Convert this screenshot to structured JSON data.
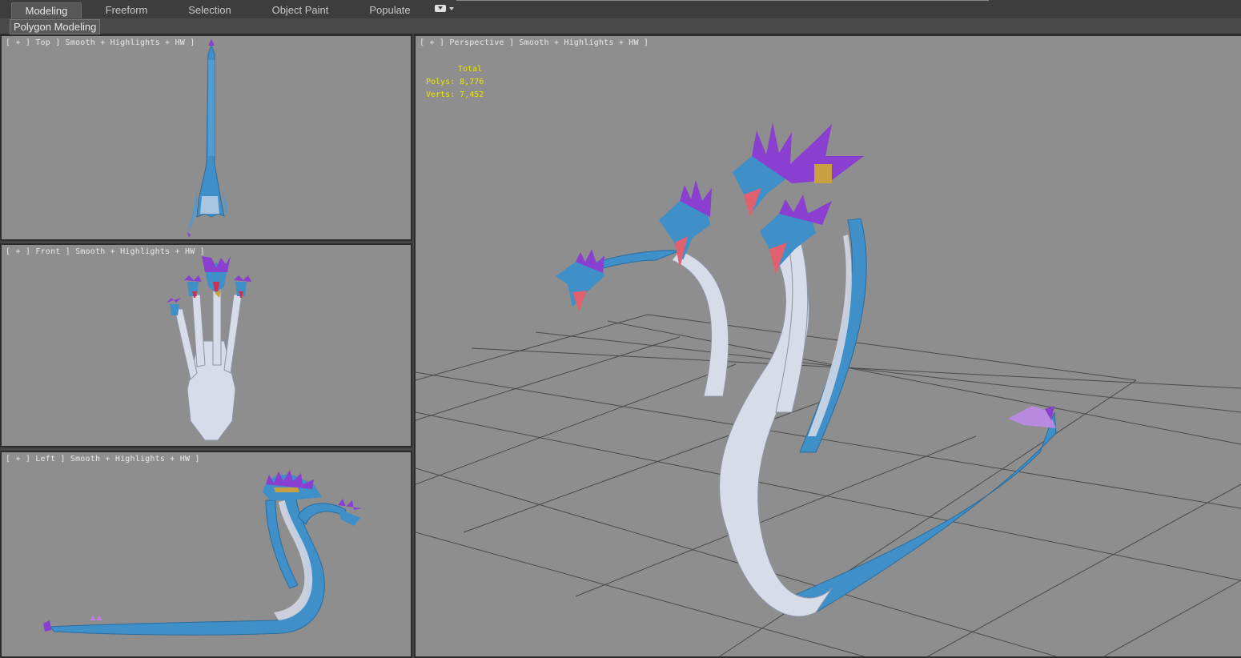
{
  "ribbon": {
    "tabs": [
      {
        "id": "modeling",
        "label": "Modeling",
        "active": true
      },
      {
        "id": "freeform",
        "label": "Freeform",
        "active": false
      },
      {
        "id": "selection",
        "label": "Selection",
        "active": false
      },
      {
        "id": "object-paint",
        "label": "Object Paint",
        "active": false
      },
      {
        "id": "populate",
        "label": "Populate",
        "active": false
      }
    ],
    "dropdown_icon": "ribbon-options-dropdown-icon"
  },
  "subribbon": {
    "panel_label": "Polygon Modeling"
  },
  "viewports": {
    "top": {
      "label": "[ + ] Top ] Smooth + Highlights + HW ]"
    },
    "front": {
      "label": "[ + ] Front ] Smooth + Highlights + HW ]"
    },
    "left": {
      "label": "[ + ] Left ] Smooth + Highlights + HW ]"
    },
    "perspective": {
      "label": "[ + ] Perspective ] Smooth + Highlights + HW ]"
    }
  },
  "stats": {
    "total_label": "Total",
    "polys_label": "Polys:",
    "polys_value": "8,776",
    "verts_label": "Verts:",
    "verts_value": "7,452",
    "color": "#e8e800"
  },
  "colors": {
    "viewport_bg": "#8e8e8e",
    "body_blue": "#3f8fc8",
    "belly_white": "#d8dce8",
    "spike_purple": "#8a3fd0",
    "grid": "#4a4a4a"
  }
}
